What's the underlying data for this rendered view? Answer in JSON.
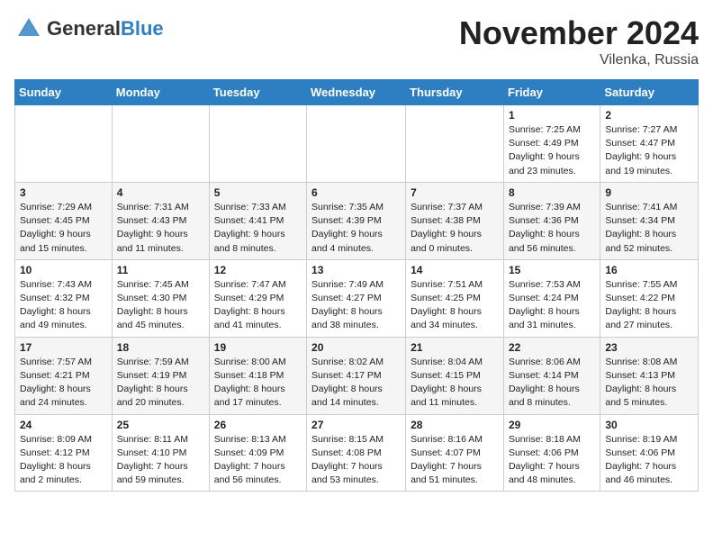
{
  "header": {
    "logo_general": "General",
    "logo_blue": "Blue",
    "month_title": "November 2024",
    "location": "Vilenka, Russia"
  },
  "days_of_week": [
    "Sunday",
    "Monday",
    "Tuesday",
    "Wednesday",
    "Thursday",
    "Friday",
    "Saturday"
  ],
  "weeks": [
    [
      {
        "day": "",
        "info": ""
      },
      {
        "day": "",
        "info": ""
      },
      {
        "day": "",
        "info": ""
      },
      {
        "day": "",
        "info": ""
      },
      {
        "day": "",
        "info": ""
      },
      {
        "day": "1",
        "info": "Sunrise: 7:25 AM\nSunset: 4:49 PM\nDaylight: 9 hours\nand 23 minutes."
      },
      {
        "day": "2",
        "info": "Sunrise: 7:27 AM\nSunset: 4:47 PM\nDaylight: 9 hours\nand 19 minutes."
      }
    ],
    [
      {
        "day": "3",
        "info": "Sunrise: 7:29 AM\nSunset: 4:45 PM\nDaylight: 9 hours\nand 15 minutes."
      },
      {
        "day": "4",
        "info": "Sunrise: 7:31 AM\nSunset: 4:43 PM\nDaylight: 9 hours\nand 11 minutes."
      },
      {
        "day": "5",
        "info": "Sunrise: 7:33 AM\nSunset: 4:41 PM\nDaylight: 9 hours\nand 8 minutes."
      },
      {
        "day": "6",
        "info": "Sunrise: 7:35 AM\nSunset: 4:39 PM\nDaylight: 9 hours\nand 4 minutes."
      },
      {
        "day": "7",
        "info": "Sunrise: 7:37 AM\nSunset: 4:38 PM\nDaylight: 9 hours\nand 0 minutes."
      },
      {
        "day": "8",
        "info": "Sunrise: 7:39 AM\nSunset: 4:36 PM\nDaylight: 8 hours\nand 56 minutes."
      },
      {
        "day": "9",
        "info": "Sunrise: 7:41 AM\nSunset: 4:34 PM\nDaylight: 8 hours\nand 52 minutes."
      }
    ],
    [
      {
        "day": "10",
        "info": "Sunrise: 7:43 AM\nSunset: 4:32 PM\nDaylight: 8 hours\nand 49 minutes."
      },
      {
        "day": "11",
        "info": "Sunrise: 7:45 AM\nSunset: 4:30 PM\nDaylight: 8 hours\nand 45 minutes."
      },
      {
        "day": "12",
        "info": "Sunrise: 7:47 AM\nSunset: 4:29 PM\nDaylight: 8 hours\nand 41 minutes."
      },
      {
        "day": "13",
        "info": "Sunrise: 7:49 AM\nSunset: 4:27 PM\nDaylight: 8 hours\nand 38 minutes."
      },
      {
        "day": "14",
        "info": "Sunrise: 7:51 AM\nSunset: 4:25 PM\nDaylight: 8 hours\nand 34 minutes."
      },
      {
        "day": "15",
        "info": "Sunrise: 7:53 AM\nSunset: 4:24 PM\nDaylight: 8 hours\nand 31 minutes."
      },
      {
        "day": "16",
        "info": "Sunrise: 7:55 AM\nSunset: 4:22 PM\nDaylight: 8 hours\nand 27 minutes."
      }
    ],
    [
      {
        "day": "17",
        "info": "Sunrise: 7:57 AM\nSunset: 4:21 PM\nDaylight: 8 hours\nand 24 minutes."
      },
      {
        "day": "18",
        "info": "Sunrise: 7:59 AM\nSunset: 4:19 PM\nDaylight: 8 hours\nand 20 minutes."
      },
      {
        "day": "19",
        "info": "Sunrise: 8:00 AM\nSunset: 4:18 PM\nDaylight: 8 hours\nand 17 minutes."
      },
      {
        "day": "20",
        "info": "Sunrise: 8:02 AM\nSunset: 4:17 PM\nDaylight: 8 hours\nand 14 minutes."
      },
      {
        "day": "21",
        "info": "Sunrise: 8:04 AM\nSunset: 4:15 PM\nDaylight: 8 hours\nand 11 minutes."
      },
      {
        "day": "22",
        "info": "Sunrise: 8:06 AM\nSunset: 4:14 PM\nDaylight: 8 hours\nand 8 minutes."
      },
      {
        "day": "23",
        "info": "Sunrise: 8:08 AM\nSunset: 4:13 PM\nDaylight: 8 hours\nand 5 minutes."
      }
    ],
    [
      {
        "day": "24",
        "info": "Sunrise: 8:09 AM\nSunset: 4:12 PM\nDaylight: 8 hours\nand 2 minutes."
      },
      {
        "day": "25",
        "info": "Sunrise: 8:11 AM\nSunset: 4:10 PM\nDaylight: 7 hours\nand 59 minutes."
      },
      {
        "day": "26",
        "info": "Sunrise: 8:13 AM\nSunset: 4:09 PM\nDaylight: 7 hours\nand 56 minutes."
      },
      {
        "day": "27",
        "info": "Sunrise: 8:15 AM\nSunset: 4:08 PM\nDaylight: 7 hours\nand 53 minutes."
      },
      {
        "day": "28",
        "info": "Sunrise: 8:16 AM\nSunset: 4:07 PM\nDaylight: 7 hours\nand 51 minutes."
      },
      {
        "day": "29",
        "info": "Sunrise: 8:18 AM\nSunset: 4:06 PM\nDaylight: 7 hours\nand 48 minutes."
      },
      {
        "day": "30",
        "info": "Sunrise: 8:19 AM\nSunset: 4:06 PM\nDaylight: 7 hours\nand 46 minutes."
      }
    ]
  ]
}
